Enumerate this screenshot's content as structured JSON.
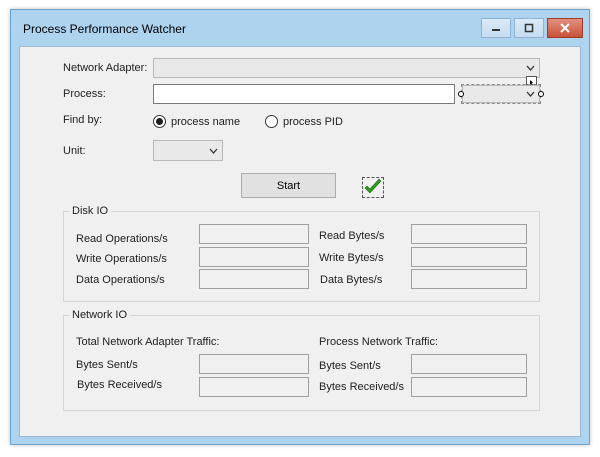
{
  "window": {
    "title": "Process Performance Watcher"
  },
  "form": {
    "network_adapter_label": "Network Adapter:",
    "process_label": "Process:",
    "process_value": "",
    "find_by_label": "Find by:",
    "radio_name_label": "process name",
    "radio_pid_label": "process PID",
    "radio_selected": "process name",
    "unit_label": "Unit:",
    "start_label": "Start"
  },
  "disk_io": {
    "title": "Disk IO",
    "read_ops_label": "Read Operations/s",
    "write_ops_label": "Write Operations/s",
    "data_ops_label": "Data Operations/s",
    "read_bytes_label": "Read Bytes/s",
    "write_bytes_label": "Write Bytes/s",
    "data_bytes_label": "Data Bytes/s"
  },
  "network_io": {
    "title": "Network IO",
    "adapter_traffic_label": "Total Network Adapter Traffic:",
    "process_traffic_label": "Process Network Traffic:",
    "adapter_sent_label": "Bytes Sent/s",
    "adapter_received_label": "Bytes Received/s",
    "process_sent_label": "Bytes Sent/s",
    "process_received_label": "Bytes Received/s"
  },
  "colors": {
    "check": "#2e9b1f",
    "frame": "#aed3ef",
    "client": "#f0f0f0"
  },
  "icons": [
    "minimize-icon",
    "maximize-icon",
    "close-icon",
    "chevron-down-icon",
    "checkmark-icon",
    "smart-tag-arrow-icon"
  ]
}
